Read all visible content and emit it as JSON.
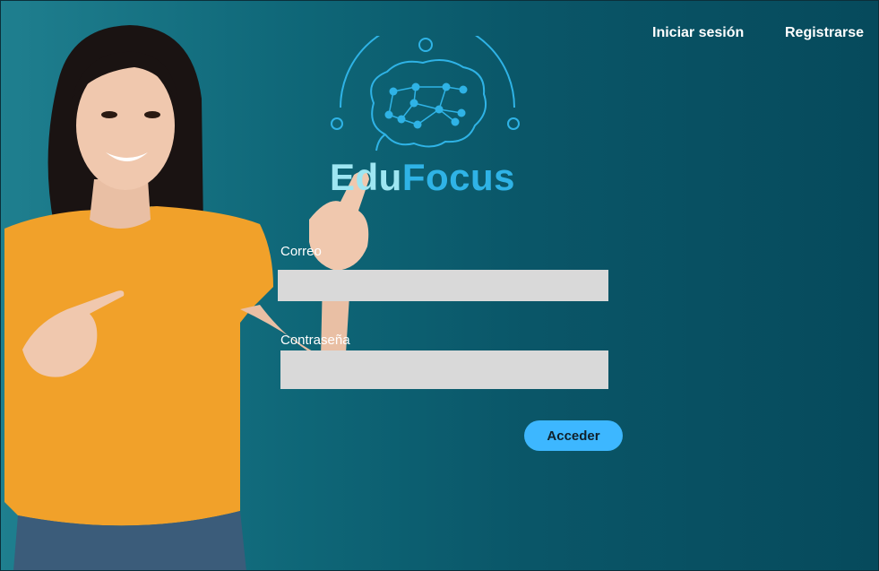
{
  "nav": {
    "login_label": "Iniciar sesión",
    "register_label": "Registrarse"
  },
  "logo": {
    "text_part1": "Edu",
    "text_part2": "Focus",
    "icon": "brain-network-icon"
  },
  "form": {
    "email_label": "Correo",
    "email_value": "",
    "password_label": "Contraseña",
    "password_value": "",
    "submit_label": "Acceder"
  },
  "colors": {
    "background": "#0a5668",
    "accent": "#3db7ff",
    "field": "#d9d9d9",
    "logo_light": "#9ee6f2",
    "logo_blue": "#2fb3e6"
  }
}
